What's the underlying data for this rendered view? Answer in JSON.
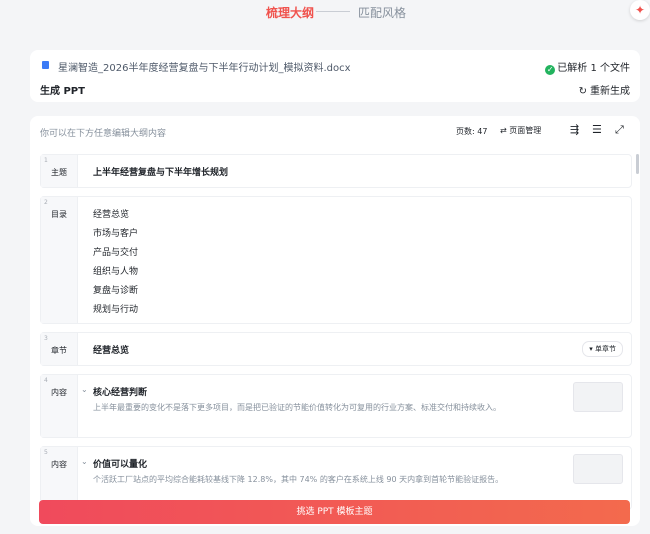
{
  "steps": {
    "active": "梳理大纲",
    "inactive": "匹配风格"
  },
  "file": {
    "name": "星澜智造_2026半年度经营复盘与下半年行动计划_模拟资料.docx",
    "status": "已解析 1 个文件",
    "generate_label": "生成 PPT",
    "regenerate_label": "重新生成"
  },
  "editor": {
    "hint": "你可以在下方任意编辑大纲内容",
    "page_count": "页数: 47",
    "page_manage": "页面管理"
  },
  "rows": [
    {
      "num": "1",
      "type": "主题",
      "title": "上半年经营复盘与下半年增长规划"
    },
    {
      "num": "2",
      "type": "目录",
      "items": [
        "经营总览",
        "市场与客户",
        "产品与交付",
        "组织与人物",
        "复盘与诊断",
        "规划与行动"
      ]
    },
    {
      "num": "3",
      "type": "章节",
      "title": "经营总览",
      "button": "单章节"
    },
    {
      "num": "4",
      "type": "内容",
      "title": "核心经营判断",
      "body": "上半年最重要的变化不是落下更多项目，而是把已验证的节能价值转化为可复用的行业方案、标准交付和持续收入。"
    },
    {
      "num": "5",
      "type": "内容",
      "title": "价值可以量化",
      "body": "个活跃工厂站点的平均综合能耗较基线下降 12.8%，其中 74% 的客户在系统上线 90 天内拿到首轮节能验证报告。"
    }
  ],
  "cta_label": "挑选 PPT 模板主题",
  "colors": {
    "accent": "#f0524d",
    "success": "#22b35e",
    "file_icon": "#3b7bf6"
  }
}
